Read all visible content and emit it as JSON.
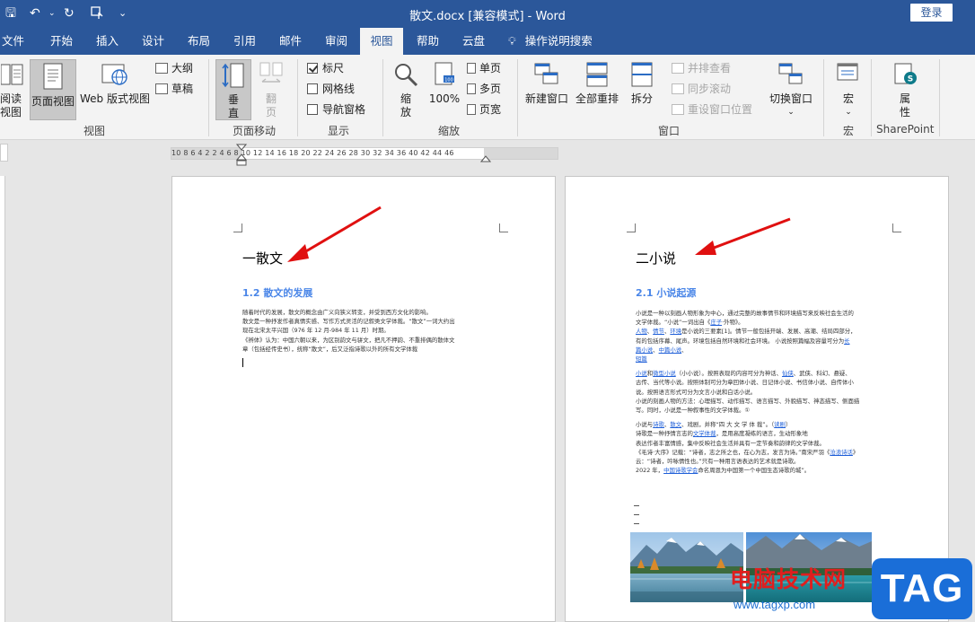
{
  "titlebar": {
    "title": "散文.docx [兼容模式]  -  Word",
    "login": "登录",
    "qa_save": "🖫",
    "qa_undo": "↶",
    "qa_redo": "↻",
    "qa_more": "⌄"
  },
  "tabs": [
    "文件",
    "开始",
    "插入",
    "设计",
    "布局",
    "引用",
    "邮件",
    "审阅",
    "视图",
    "帮助",
    "云盘"
  ],
  "active_tab": "视图",
  "tell_me": "操作说明搜索",
  "ribbon": {
    "views": {
      "read_mode": "阅读\n视图",
      "print_layout": "页面视图",
      "web_layout": "Web 版式视图",
      "outline": "大纲",
      "draft": "草稿",
      "label": "视图"
    },
    "page_movement": {
      "vertical": "垂\n直",
      "side_to_side": "翻\n页",
      "label": "页面移动"
    },
    "show": {
      "ruler": "标尺",
      "gridlines": "网格线",
      "nav_pane": "导航窗格",
      "ruler_checked": true,
      "gridlines_checked": false,
      "nav_pane_checked": false,
      "label": "显示"
    },
    "zoom": {
      "zoom": "缩\n放",
      "hundred": "100%",
      "one_page": "单页",
      "multi_page": "多页",
      "page_width": "页宽",
      "label": "缩放"
    },
    "window": {
      "new_window": "新建窗口",
      "arrange_all": "全部重排",
      "split": "拆分",
      "side_by_side": "并排查看",
      "sync_scroll": "同步滚动",
      "reset_pos": "重设窗口位置",
      "switch": "切换窗口",
      "label": "窗口"
    },
    "macros": {
      "macros": "宏",
      "label": "宏"
    },
    "sharepoint": {
      "properties": "属\n性",
      "label": "SharePoint"
    }
  },
  "ruler_text": "10  8  6  4  2     2   4   6   8  10  12  14  16  18  20  22  24  26  28  30  32  34  36     40  42  44  46",
  "page1": {
    "heading": "一散文",
    "subheading": "1.2 散文的发展",
    "para": [
      "随着时代的发展，散文的概念由广义向狭义转变，并受到西方文化的影响。",
      "散文是一种抒发作者真情实感、写作方式灵活的记叙类文学体裁。“散文”一词大约出",
      "现在北宋太平兴国（976 年 12 月-984 年 11 月）时期。",
      "《辨体》认为：中国六朝以来，为区别韵文与骈文，把凡不押韵、不重排偶的散体文",
      "章（包括经传史书），统称“散文”，后又泛指诗歌以外的所有文学体裁"
    ]
  },
  "page2": {
    "heading": "二小说",
    "subheading": "2.1 小说起源",
    "para1": [
      [
        "小说是一种以刻画人物形象为中心，通过完整的故事情节和环境描写来反映社会生活的",
        ""
      ],
      [
        "文学体裁。“小说”一词出自《",
        ""
      ]
    ],
    "p_a1": "小说是一种以刻画人物形象为中心，通过完整的故事情节和环境描写来反映社会生活的",
    "p_a2_pre": "文学体裁。“小说”一词出自《",
    "p_a2_link": "庄子",
    "p_a2_post": "·外物》。",
    "p_b_l1": "人物",
    "p_b_s1": "、",
    "p_b_l2": "情节",
    "p_b_s2": "、",
    "p_b_l3": "环境",
    "p_b_post": "是小说的三要素[1]。情节一般包括开端、发展、高潮、结局四部分，",
    "p_c": "有的包括序幕、尾声。环境包括自然环境和社会环境。 小说按照篇幅及容量可分为",
    "p_c_link": "长",
    "p_d_l1": "篇小说",
    "p_d_s": "、",
    "p_d_l2": "中篇小说",
    "p_d_post": "、",
    "p_e_link": "短篇",
    "p_f_l1": "小说",
    "p_f_s": "和",
    "p_f_l2": "微型小说",
    "p_f_post": "（小小说）。按照表现的内容可分为神话、",
    "p_f_l3": "仙侠",
    "p_f_post2": "、武侠、科幻、悬疑、",
    "p_g": "古传、当代等小说。按照体制可分为章回体小说、日记体小说、书信体小说、自传体小",
    "p_h": "说。按照语言形式可分为文言小说和白话小说。",
    "p_i": "小说的刻画人物的方法：心理描写、动作描写、语言描写、外貌描写、神态描写、侧面描",
    "p_j": "写。同时，小说是一种叙事性的文学体裁。①",
    "p_k_pre": "小说与",
    "p_k_l1": "诗歌",
    "p_k_s1": "、",
    "p_k_l2": "散文",
    "p_k_post": "、戏剧，并称“四 大 文 学 体 裁”。（",
    "p_k_l3": "读剧",
    "p_k_end": "）",
    "p_l_pre": "诗歌是一种抒情言志的",
    "p_l_link": "文学体裁",
    "p_l_post": "，是用高度凝练的语言，生动形象地",
    "p_m": "表达作者丰富情感，集中反映社会生活并具有一定节奏和韵律的文学体裁。",
    "p_n_pre": "《毛诗·大序》记载：“诗者，志之所之也，在心为志，发言为诗。”南宋严羽《",
    "p_n_link": "沧浪诗话",
    "p_n_post": "》",
    "p_o": "云：“诗者，吟咏情性也。”只有一种用言语表达的艺术就是诗歌。",
    "p_p_pre": "2022 年，",
    "p_p_link": "中国诗歌学会",
    "p_p_post": "命名周恩为中国第一个中国生态诗歌的城”。"
  },
  "watermark": {
    "site_name": "电脑技术网",
    "url": "www.tagxp.com",
    "tag": "TAG"
  }
}
